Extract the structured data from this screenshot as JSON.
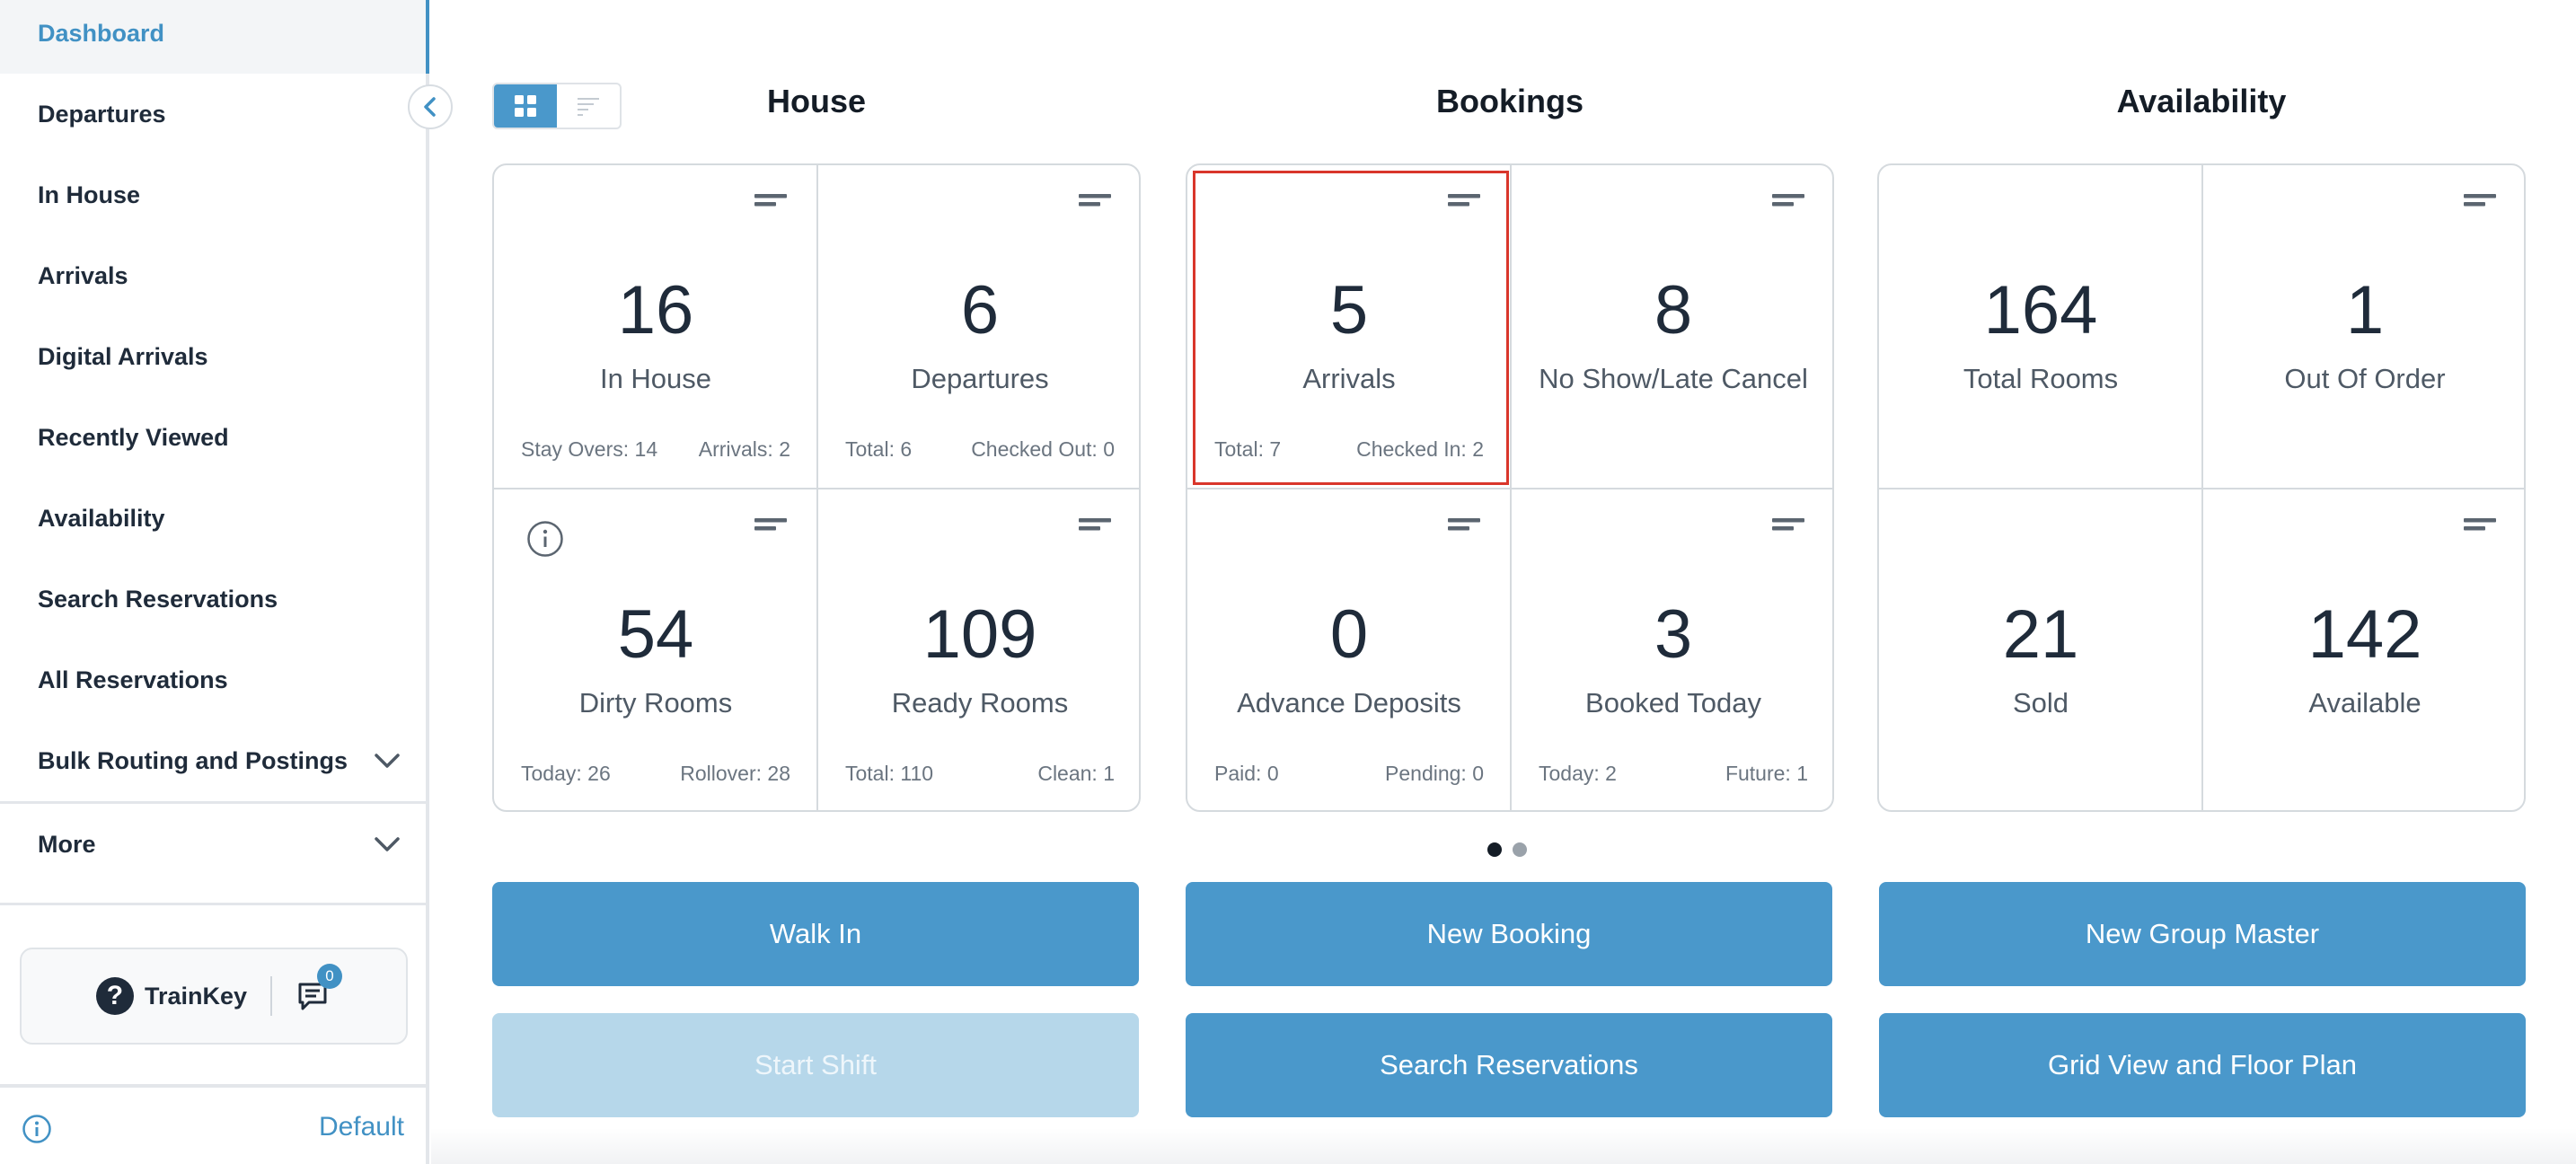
{
  "sidebar": {
    "items": [
      {
        "label": "Dashboard"
      },
      {
        "label": "Departures"
      },
      {
        "label": "In House"
      },
      {
        "label": "Arrivals"
      },
      {
        "label": "Digital Arrivals"
      },
      {
        "label": "Recently Viewed"
      },
      {
        "label": "Availability"
      },
      {
        "label": "Search Reservations"
      },
      {
        "label": "All Reservations"
      },
      {
        "label": "Bulk Routing and Postings"
      },
      {
        "label": "More"
      }
    ],
    "trainkey_label": "TrainKey",
    "message_count": "0",
    "footer_label": "Default"
  },
  "sections": {
    "house": "House",
    "bookings": "Bookings",
    "availability": "Availability"
  },
  "house": {
    "in_house": {
      "value": "16",
      "label": "In House",
      "left": "Stay Overs: 14",
      "right": "Arrivals: 2"
    },
    "departures": {
      "value": "6",
      "label": "Departures",
      "left": "Total: 6",
      "right": "Checked Out: 0"
    },
    "dirty": {
      "value": "54",
      "label": "Dirty Rooms",
      "left": "Today: 26",
      "right": "Rollover: 28"
    },
    "ready": {
      "value": "109",
      "label": "Ready Rooms",
      "left": "Total: 110",
      "right": "Clean: 1"
    }
  },
  "bookings": {
    "arrivals": {
      "value": "5",
      "label": "Arrivals",
      "left": "Total: 7",
      "right": "Checked In: 2"
    },
    "noshow": {
      "value": "8",
      "label": "No Show/Late Cancel"
    },
    "deposits": {
      "value": "0",
      "label": "Advance Deposits",
      "left": "Paid: 0",
      "right": "Pending: 0"
    },
    "booked_today": {
      "value": "3",
      "label": "Booked Today",
      "left": "Today: 2",
      "right": "Future: 1"
    }
  },
  "availability": {
    "total_rooms": {
      "value": "164",
      "label": "Total Rooms"
    },
    "out_of_order": {
      "value": "1",
      "label": "Out Of Order"
    },
    "sold": {
      "value": "21",
      "label": "Sold"
    },
    "available": {
      "value": "142",
      "label": "Available"
    }
  },
  "actions": {
    "walk_in": "Walk In",
    "new_booking": "New Booking",
    "new_group_master": "New Group Master",
    "start_shift": "Start Shift",
    "search_reservations": "Search Reservations",
    "grid_view": "Grid View and Floor Plan"
  },
  "colors": {
    "accent": "#4a98cb",
    "accent_disabled": "#b6d7ea",
    "highlight": "#d9362b",
    "active_nav": "#4191c4"
  }
}
